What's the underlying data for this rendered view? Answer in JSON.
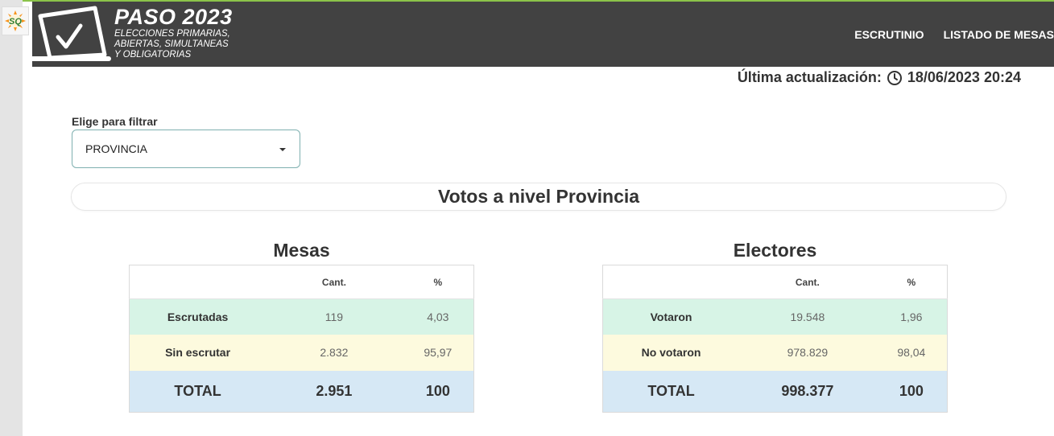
{
  "header": {
    "brand_title": "PASO 2023",
    "brand_subtitle": [
      "ELECCIONES PRIMARIAS,",
      "ABIERTAS, SIMULTANEAS",
      "Y OBLIGATORIAS"
    ],
    "favicon_text": "SQ",
    "nav": [
      "ESCRUTINIO",
      "LISTADO DE MESAS"
    ]
  },
  "update": {
    "label": "Última actualización:",
    "value": "18/06/2023 20:24",
    "icon": "clock-icon"
  },
  "filter": {
    "label": "Elige para filtrar",
    "selected": "PROVINCIA"
  },
  "section_title": "Votos a nivel Provincia",
  "mesas": {
    "title": "Mesas",
    "columns": [
      "",
      "Cant.",
      "%"
    ],
    "rows": [
      {
        "label": "Escrutadas",
        "cant": "119",
        "pct": "4,03"
      },
      {
        "label": "Sin escrutar",
        "cant": "2.832",
        "pct": "95,97"
      },
      {
        "label": "TOTAL",
        "cant": "2.951",
        "pct": "100"
      }
    ]
  },
  "electores": {
    "title": "Electores",
    "columns": [
      "",
      "Cant.",
      "%"
    ],
    "rows": [
      {
        "label": "Votaron",
        "cant": "19.548",
        "pct": "1,96"
      },
      {
        "label": "No votaron",
        "cant": "978.829",
        "pct": "98,04"
      },
      {
        "label": "TOTAL",
        "cant": "998.377",
        "pct": "100"
      }
    ]
  },
  "colors": {
    "header_bg": "#424242",
    "row_green": "#d7f4e6",
    "row_yellow": "#fdfade",
    "row_blue": "#d6e8f5",
    "accent_green": "#8bc34a"
  }
}
